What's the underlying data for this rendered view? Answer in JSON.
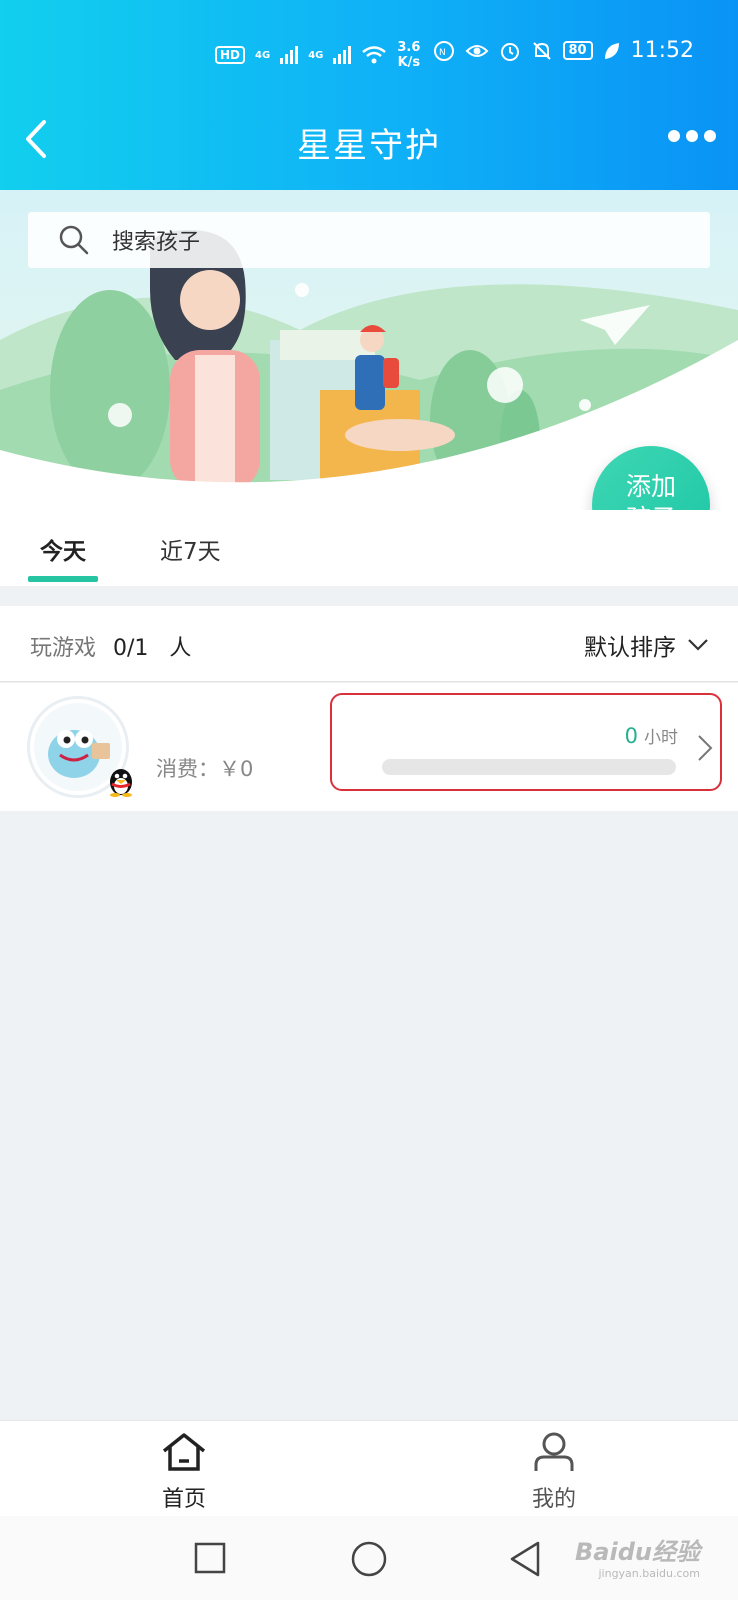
{
  "status_bar": {
    "hd": "HD",
    "net1": "4G",
    "net2": "4G",
    "speed_value": "3.6",
    "speed_unit": "K/s",
    "battery": "80",
    "time": "11:52"
  },
  "header": {
    "title": "星星守护"
  },
  "search": {
    "placeholder": "搜索孩子"
  },
  "add_child": {
    "line1": "添加",
    "line2": "孩子"
  },
  "tabs": [
    {
      "label": "今天",
      "active": true
    },
    {
      "label": "近7天",
      "active": false
    }
  ],
  "summary": {
    "label": "玩游戏",
    "count": "0/1",
    "unit": "人",
    "sort_label": "默认排序"
  },
  "children": [
    {
      "spend_label": "消费：",
      "spend_value": "￥0",
      "hours_value": "0",
      "hours_unit": "小时",
      "progress": 0
    }
  ],
  "bottom_nav": {
    "home": "首页",
    "me": "我的"
  },
  "watermark": {
    "brand": "Baidu经验",
    "url": "jingyan.baidu.com"
  },
  "colors": {
    "accent": "#25c4a2",
    "header_start": "#12cfee",
    "header_end": "#0a93f5",
    "highlight": "#d9313c"
  }
}
